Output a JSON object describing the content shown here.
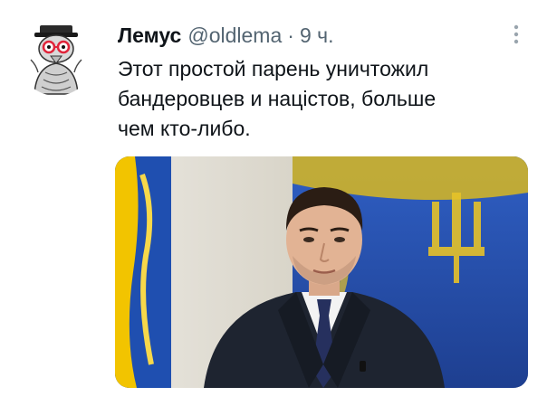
{
  "tweet": {
    "author_name": "Лемус",
    "handle": "@oldlema",
    "separator": "·",
    "time": "9 ч.",
    "text_lines": [
      "Этот простой парень уничтожил",
      "бандеровцев и націстов, больше",
      "чем кто-либо."
    ]
  },
  "icons": {
    "avatar": "cartoon-character-avatar",
    "more": "more-options-icon"
  },
  "colors": {
    "text_primary": "#0f1419",
    "text_secondary": "#536471",
    "flag_blue": "#1f4fb0",
    "flag_yellow": "#f2c400"
  }
}
